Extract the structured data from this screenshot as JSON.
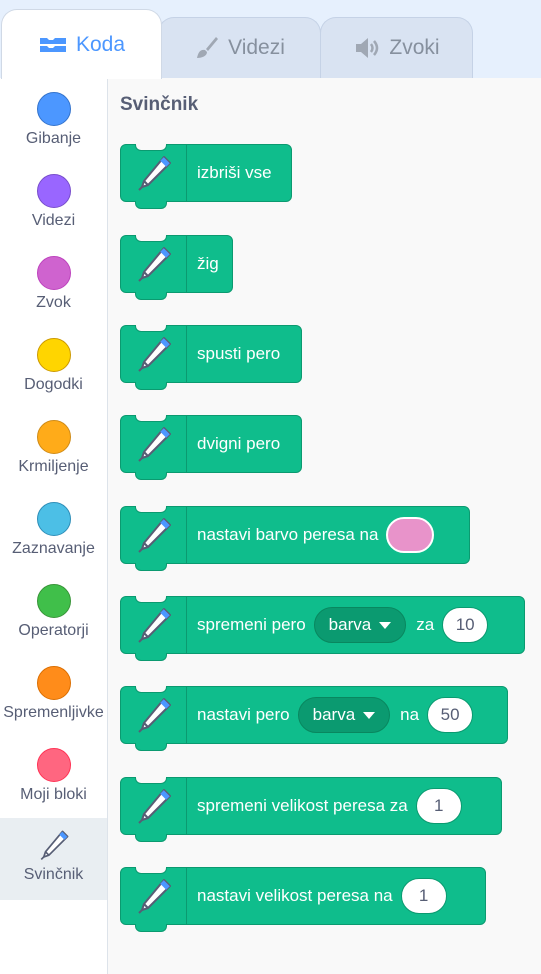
{
  "tabs": [
    {
      "label": "Koda",
      "icon": "code-icon",
      "active": true
    },
    {
      "label": "Videzi",
      "icon": "brush-icon",
      "active": false
    },
    {
      "label": "Zvoki",
      "icon": "speaker-icon",
      "active": false
    }
  ],
  "categories": [
    {
      "label": "Gibanje",
      "color": "#4c97ff",
      "border": "#3373cc"
    },
    {
      "label": "Videzi",
      "color": "#9966ff",
      "border": "#774dcb"
    },
    {
      "label": "Zvok",
      "color": "#cf63cf",
      "border": "#bd42bd"
    },
    {
      "label": "Dogodki",
      "color": "#ffd500",
      "border": "#cc9900"
    },
    {
      "label": "Krmiljenje",
      "color": "#ffab19",
      "border": "#cf8b17"
    },
    {
      "label": "Zaznavanje",
      "color": "#4cbfe6",
      "border": "#2e8eb8"
    },
    {
      "label": "Operatorji",
      "color": "#40bf4a",
      "border": "#389438"
    },
    {
      "label": "Spremenljivke",
      "color": "#ff8c1a",
      "border": "#db6e00"
    },
    {
      "label": "Moji bloki",
      "color": "#ff6680",
      "border": "#ff3355"
    },
    {
      "label": "Svinčnik",
      "icon": "pen-icon",
      "selected": true
    }
  ],
  "palette": {
    "title": "Svinčnik",
    "blocks": {
      "clear": {
        "text": "izbriši vse"
      },
      "stamp": {
        "text": "žig"
      },
      "pen_down": {
        "text": "spusti pero"
      },
      "pen_up": {
        "text": "dvigni pero"
      },
      "set_color": {
        "text": "nastavi barvo peresa na",
        "swatch_color": "#e893ca"
      },
      "change_param": {
        "text": "spremeni pero",
        "dropdown": "barva",
        "text2": "za",
        "value": "10"
      },
      "set_param": {
        "text": "nastavi pero",
        "dropdown": "barva",
        "text2": "na",
        "value": "50"
      },
      "change_size": {
        "text": "spremeni velikost peresa za",
        "value": "1"
      },
      "set_size": {
        "text": "nastavi velikost peresa na",
        "value": "1"
      }
    }
  },
  "colors": {
    "pen_block": "#0fbd8c",
    "pen_block_border": "#0b9a70",
    "accent": "#4c97ff"
  }
}
